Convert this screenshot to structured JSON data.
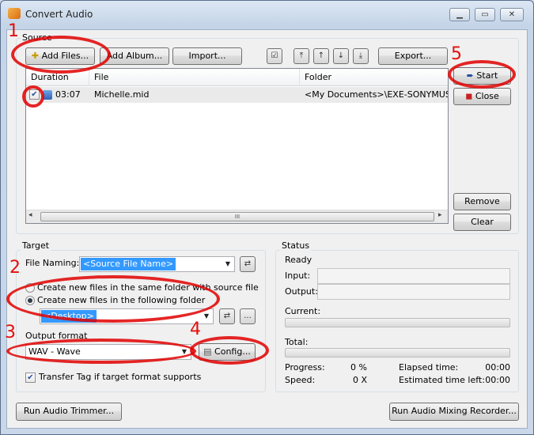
{
  "window": {
    "title": "Convert Audio",
    "min": "▁",
    "max": "▭",
    "close": "✕"
  },
  "source": {
    "legend": "Source",
    "add_files": "Add Files...",
    "add_album": "Add Album...",
    "import": "Import...",
    "export": "Export...",
    "columns": [
      "Duration",
      "File",
      "Folder"
    ],
    "rows": [
      {
        "checked": true,
        "duration": "03:07",
        "file": "Michelle.mid",
        "folder": "<My Documents>\\EXE-SONYMUS"
      }
    ],
    "scroll_left": "◂",
    "scroll_right": "▸",
    "scroll_grip": "III"
  },
  "side_buttons": {
    "start": "Start",
    "close": "Close",
    "remove": "Remove",
    "clear": "Clear"
  },
  "target": {
    "legend": "Target",
    "file_naming_label": "File Naming:",
    "file_naming_value": "<Source File Name>",
    "radio_same": "Create new files in the same folder with source file",
    "radio_following": "Create new files in the following folder",
    "folder_value": "<Desktop>",
    "browse": "...",
    "output_format_label": "Output format",
    "output_format_value": "WAV - Wave",
    "config": "Config...",
    "transfer_tag": "Transfer Tag if target format supports"
  },
  "status": {
    "legend": "Status",
    "state": "Ready",
    "input_label": "Input:",
    "output_label": "Output:",
    "current_label": "Current:",
    "current_progress": 0,
    "total_label": "Total:",
    "total_progress": 0,
    "progress_label": "Progress:",
    "progress_value": "0 %",
    "speed_label": "Speed:",
    "speed_value": "0 X",
    "elapsed_label": "Elapsed time:",
    "elapsed_value": "00:00",
    "remaining_label": "Estimated time left:",
    "remaining_value": "00:00"
  },
  "footer": {
    "trimmer": "Run Audio Trimmer...",
    "mixing": "Run Audio Mixing Recorder..."
  },
  "annotations": [
    "1",
    "2",
    "3",
    "4",
    "5"
  ],
  "colors": {
    "highlight": "#e30f0f",
    "selection": "#3399ff"
  }
}
